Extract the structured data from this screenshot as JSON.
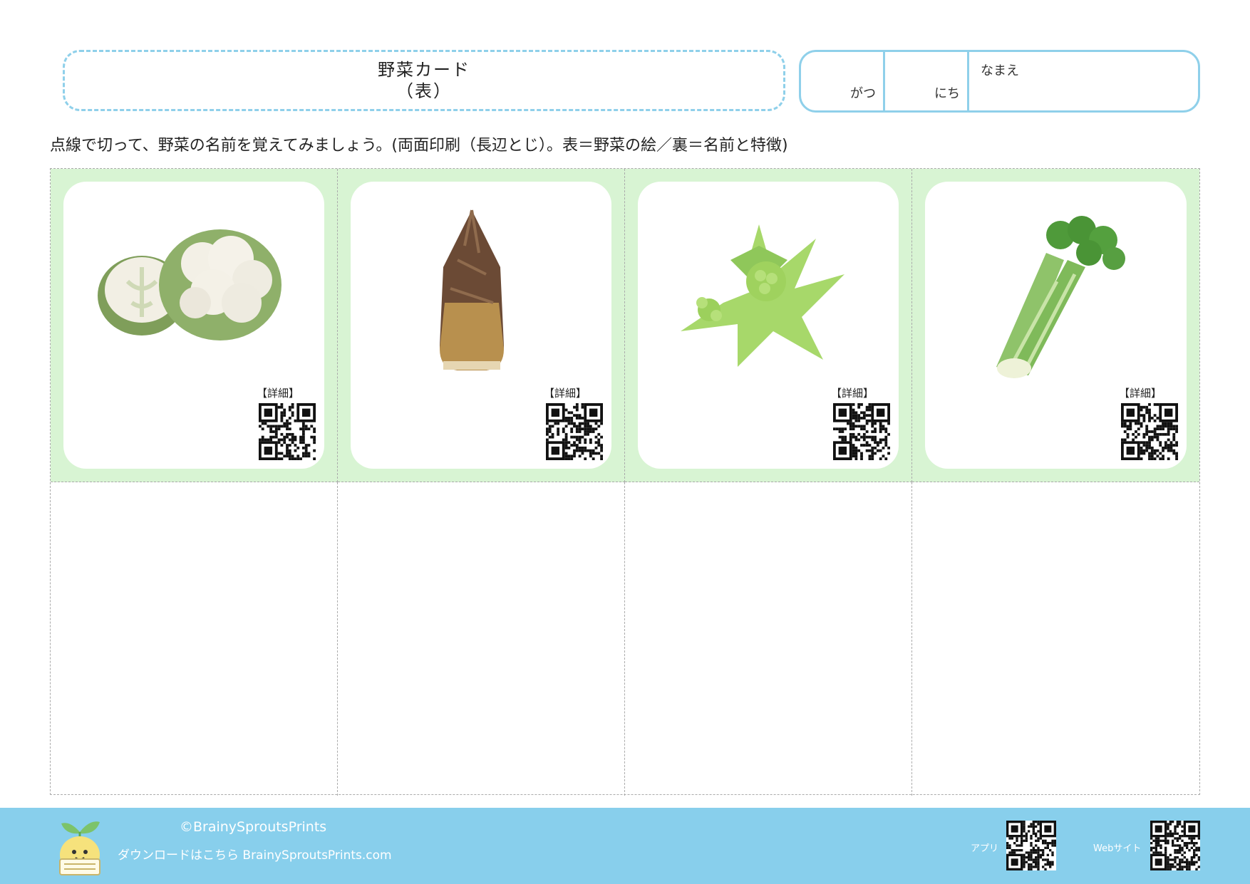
{
  "header": {
    "title": "野菜カード",
    "subtitle": "（表）"
  },
  "name_box": {
    "month_label": "がつ",
    "day_label": "にち",
    "name_label": "なまえ"
  },
  "instruction": "点線で切って、野菜の名前を覚えてみましょう。(両面印刷（長辺とじ）。表＝野菜の絵／裏＝名前と特徴)",
  "cards": [
    {
      "icon": "cauliflower-icon",
      "detail_label": "【詳細】"
    },
    {
      "icon": "bamboo-shoot-icon",
      "detail_label": "【詳細】"
    },
    {
      "icon": "butterbur-sprout-icon",
      "detail_label": "【詳細】"
    },
    {
      "icon": "celery-icon",
      "detail_label": "【詳細】"
    }
  ],
  "footer": {
    "copyright": "©BrainySproutsPrints",
    "download_text": "ダウンロードはこちら BrainySproutsPrints.com",
    "app_label": "アプリ",
    "web_label": "Webサイト"
  },
  "colors": {
    "accent_blue": "#8fd0ea",
    "footer_blue": "#88cfec",
    "card_green": "#d8f4d3"
  }
}
